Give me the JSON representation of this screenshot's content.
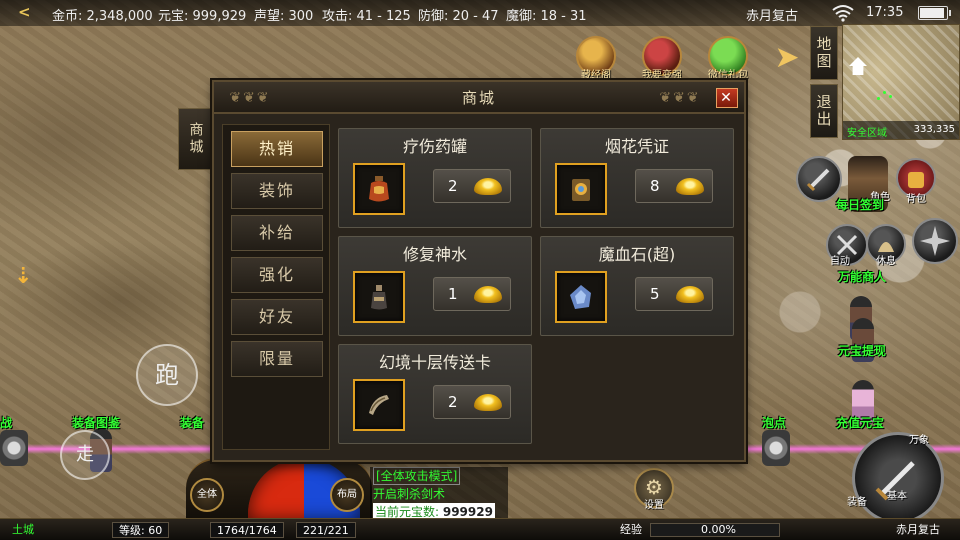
{
  "topbar": {
    "back_glyph": "<",
    "gold": "金币: 2,348,000",
    "yuanbao": "元宝: 999,929",
    "fame": "声望: 300",
    "attack": "攻击: 41 - 125",
    "defense": "防御: 20 - 47",
    "magic_defense": "魔御: 18 - 31",
    "server": "赤月复古",
    "time": "17:35"
  },
  "functions": [
    {
      "label": "藏经阁",
      "icon": "scroll-pavilion-icon"
    },
    {
      "label": "我要变强",
      "icon": "warrior-strength-icon"
    },
    {
      "label": "微信礼包",
      "icon": "wechat-gift-icon"
    }
  ],
  "minimap": {
    "map_label": "地图",
    "exit_label": "退出",
    "zone_name": "安全区域",
    "coords": "333,335"
  },
  "right_panel": {
    "role_label": "角色",
    "bag_label": "背包",
    "checkin_label": "每日签到",
    "auto_label": "自动",
    "pet_label": "休息",
    "merchant_label": "万能商人",
    "yuanbao_withdraw": "元宝提现",
    "recharge": "充值元宝",
    "attack_main": "基本",
    "attack_top": "万象",
    "attack_bottom": "装备",
    "bubble_point": "泡点"
  },
  "left_panel": {
    "run_label": "跑",
    "walk_label": "走",
    "npc_combat": "战",
    "npc_equip_guide": "装备图鉴",
    "npc_equip2": "装备"
  },
  "shop": {
    "title": "商城",
    "side_tab": "商城",
    "close_glyph": "✕",
    "categories": [
      "热销",
      "装饰",
      "补给",
      "强化",
      "好友",
      "限量"
    ],
    "active_category": "热销",
    "items": [
      {
        "name": "疗伤药罐",
        "price": "2",
        "icon": "healing-potion-jar-icon"
      },
      {
        "name": "烟花凭证",
        "price": "8",
        "icon": "firework-voucher-icon"
      },
      {
        "name": "修复神水",
        "price": "1",
        "icon": "repair-water-bottle-icon"
      },
      {
        "name": "魔血石(超)",
        "price": "5",
        "icon": "blood-stone-icon"
      },
      {
        "name": "幻境十层传送卡",
        "price": "2",
        "icon": "teleport-card-icon"
      }
    ],
    "currency_icon": "gold-ingot-icon"
  },
  "bottom": {
    "zone": "土城",
    "level": "等级: 60",
    "hp": "1764/1764",
    "mp": "221/221",
    "exp_label": "经验",
    "exp_value": "0.00%",
    "exp_percent": 0,
    "server": "赤月复古",
    "orb_left": "全体",
    "orb_right": "布局",
    "settings_label": "设置"
  },
  "chat": {
    "line1": "[全体攻击模式]",
    "line2": "开启刺杀剑术",
    "line3_label": "当前元宝数: ",
    "line3_value": "999929"
  },
  "colors": {
    "npc_green": "#33ff33",
    "accent_gold": "#e0a020",
    "panel_bg": "#2a241c",
    "beam_pink": "#ff78e6"
  }
}
